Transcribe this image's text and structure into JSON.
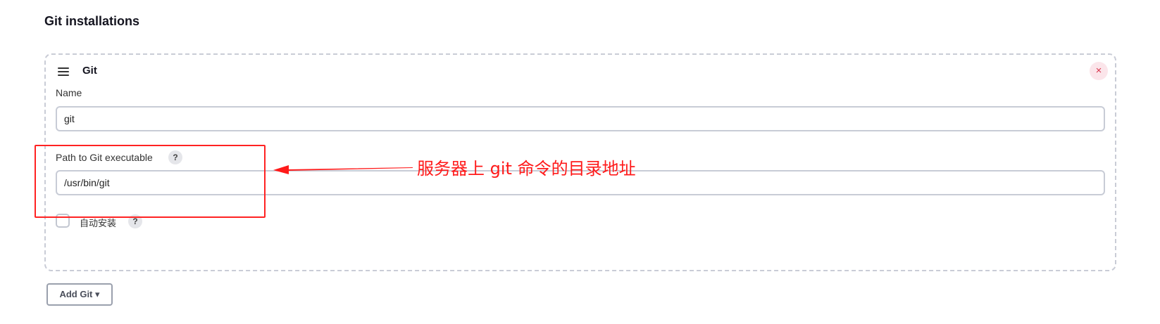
{
  "section": {
    "title": "Git installations"
  },
  "card": {
    "title": "Git",
    "close_symbol": "×",
    "name_label": "Name",
    "name_value": "git",
    "path_label": "Path to Git executable",
    "path_value": "/usr/bin/git",
    "help_symbol": "?",
    "auto_install_label": "自动安装",
    "auto_install_checked": false
  },
  "add_button": {
    "label": "Add Git ▾"
  },
  "annotation": {
    "text": "服务器上 git 命令的目录地址",
    "color": "#ff1a1a"
  },
  "icons": {
    "drag": "drag-handle-icon",
    "close": "close-icon",
    "help": "help-icon",
    "caret": "caret-down-icon"
  }
}
